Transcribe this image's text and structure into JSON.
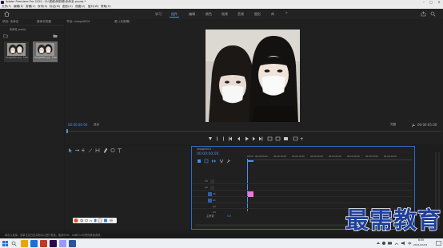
{
  "titlebar": {
    "title": "Adobe Premiere Pro 2020 - D:\\视频\\快剪辑\\未命名.prproj *"
  },
  "menubar": {
    "items": [
      "文件(F)",
      "编辑(E)",
      "剪辑(C)",
      "序列(S)",
      "标记(M)",
      "图形(G)",
      "视图(V)",
      "窗口(W)",
      "帮助(H)"
    ]
  },
  "workspaces": {
    "items": [
      "学习",
      "组件",
      "编辑",
      "颜色",
      "效果",
      "音频",
      "图形",
      "库"
    ],
    "active": "组件"
  },
  "project_panel": {
    "tabs": [
      "项目: 未命名",
      "媒体浏览器",
      "库"
    ],
    "path": "未命名.prproj",
    "items": [
      {
        "name": "Image0001.jpg",
        "duration": "5:00"
      },
      {
        "name": "Image0001.jpg",
        "duration": "5:00"
      }
    ]
  },
  "program_panel": {
    "tabs": [
      "节目: Image0001",
      "源: (无剪辑)"
    ],
    "timecode_left": "00:00:00:00",
    "fit": "适合",
    "quality": "完整",
    "timecode_right": "00:00:05:00"
  },
  "timeline": {
    "tab": "Image0001",
    "timecode": "00:00:00:00",
    "ruler": [
      "00:00",
      "00:00:05:00",
      "00:00:10:00",
      "00:00:15:00",
      "00:00:20:00",
      "00:00:25:00",
      "00:00:30:00",
      "00:00:35:00",
      "00:00:40:00",
      "00:00:45:00"
    ],
    "tracks": [
      "V3",
      "V2",
      "V1",
      "A1",
      "A2",
      "A3"
    ],
    "master_label": "主声道",
    "master_value": "0.0"
  },
  "statusbar": {
    "text": "单击以选择，或单击空白处并拖动以进行框选。使用Shift、Alt和Ctrl可获得其他选项。"
  },
  "taskbar": {
    "time": "8:55",
    "date": "2021/10/22"
  },
  "watermark": {
    "text": "最需教育"
  },
  "colors": {
    "accent": "#4f8fe8",
    "clip": "#e97bd8",
    "watermark": "#1f3f9c"
  }
}
